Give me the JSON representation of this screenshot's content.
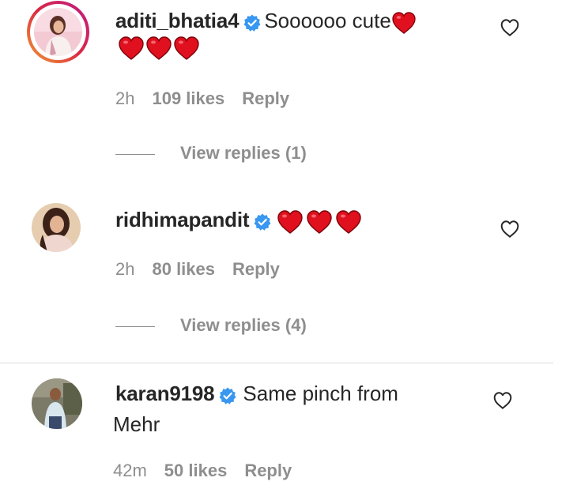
{
  "comments": [
    {
      "username": "aditi_bhatia4",
      "text": "Soooooo cute",
      "time": "2h",
      "likes": "109 likes",
      "reply": "Reply",
      "view_replies": "View replies (1)"
    },
    {
      "username": "ridhimapandit",
      "text": "",
      "time": "2h",
      "likes": "80 likes",
      "reply": "Reply",
      "view_replies": "View replies (4)"
    },
    {
      "username": "karan9198",
      "text_line1": "Same pinch from",
      "text_line2": "Mehr",
      "time": "42m",
      "likes": "50 likes",
      "reply": "Reply"
    }
  ],
  "colors": {
    "verified": "#3897f0",
    "heart": "#e0101e",
    "muted": "#8e8e8e",
    "text": "#262626"
  },
  "icons": [
    "verified-badge-icon",
    "heart-emoji-icon",
    "like-heart-outline-icon"
  ]
}
